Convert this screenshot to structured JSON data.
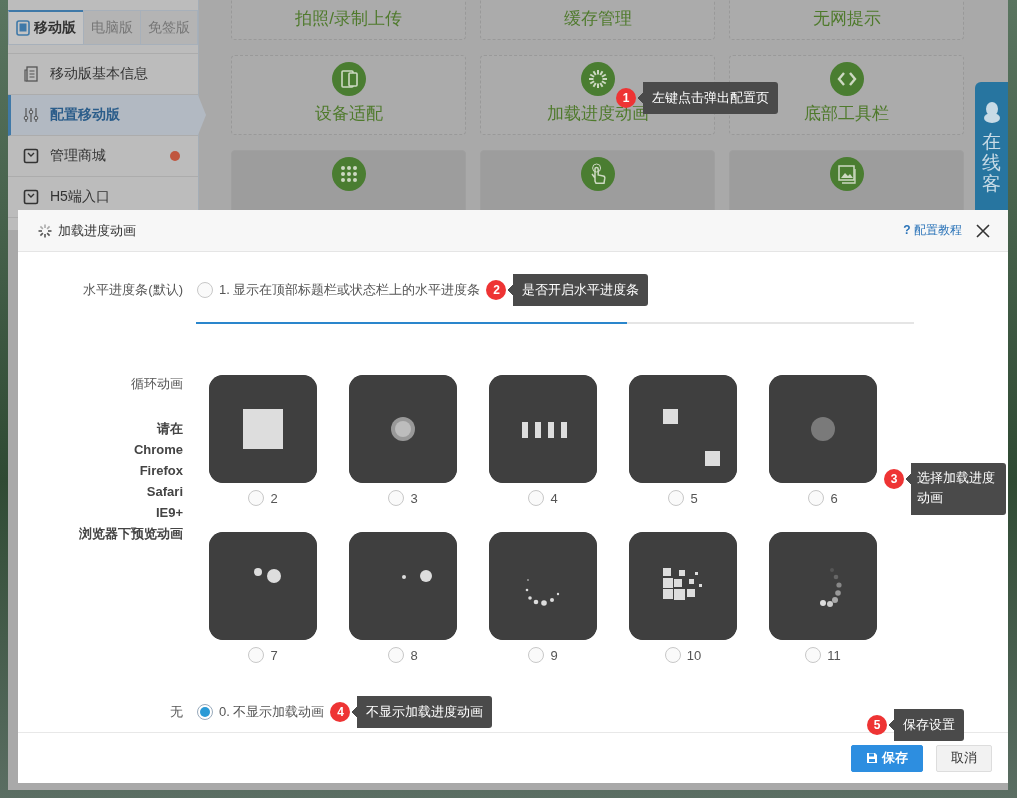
{
  "sidebar": {
    "tabs": [
      {
        "label": "移动版",
        "selected": true
      },
      {
        "label": "电脑版",
        "selected": false
      },
      {
        "label": "免签版",
        "selected": false
      }
    ],
    "items": [
      {
        "label": "移动版基本信息",
        "selected": false,
        "badge": false
      },
      {
        "label": "配置移动版",
        "selected": true,
        "badge": false
      },
      {
        "label": "管理商城",
        "selected": false,
        "badge": true
      },
      {
        "label": "H5端入口",
        "selected": false,
        "badge": false
      }
    ]
  },
  "features": [
    {
      "label": "拍照/录制上传",
      "kind": "outline"
    },
    {
      "label": "缓存管理",
      "kind": "outline"
    },
    {
      "label": "无网提示",
      "kind": "outline"
    },
    {
      "label": "设备适配",
      "kind": "outline"
    },
    {
      "label": "加载进度动画",
      "kind": "outline",
      "callout": {
        "number": "1",
        "text": "左键点击弹出配置页"
      }
    },
    {
      "label": "底部工具栏",
      "kind": "outline"
    },
    {
      "kind": "filled"
    },
    {
      "kind": "filled"
    },
    {
      "kind": "filled"
    }
  ],
  "online_service": {
    "label": "在线客"
  },
  "dialog": {
    "title": "加载进度动画",
    "help_link": "**?** 配置教程",
    "horizontal": {
      "label": "水平进度条(默认)",
      "option": "1. 显示在顶部标题栏或状态栏上的水平进度条",
      "selected": false,
      "callout": {
        "number": "2",
        "text": "是否开启水平进度条"
      }
    },
    "preview_bar": {
      "level": 0.6
    },
    "loop": {
      "label": "循环动画",
      "hint": "请在\nChrome\nFirefox\nSafari\nIE9+\n浏览器下预览动画",
      "options": [
        {
          "number": "2",
          "kind": "square",
          "selected": false
        },
        {
          "number": "3",
          "kind": "ring-dot",
          "selected": false
        },
        {
          "number": "4",
          "kind": "bars",
          "selected": false
        },
        {
          "number": "5",
          "kind": "two-squares",
          "selected": false
        },
        {
          "number": "6",
          "kind": "dot",
          "selected": false
        },
        {
          "number": "7",
          "kind": "two-dots",
          "selected": false
        },
        {
          "number": "8",
          "kind": "small-big-dot",
          "selected": false
        },
        {
          "number": "9",
          "kind": "dot-arc",
          "selected": false
        },
        {
          "number": "10",
          "kind": "square-cluster",
          "selected": false
        },
        {
          "number": "11",
          "kind": "fade-arc",
          "selected": false
        }
      ],
      "callout": {
        "number": "3",
        "text": "选择加载进度动画"
      }
    },
    "none": {
      "label": "无",
      "option": "0. 不显示加载动画",
      "selected": true,
      "callout": {
        "number": "4",
        "text": "不显示加载进度动画"
      }
    },
    "buttons": [
      {
        "label": "保存",
        "kind": "primary",
        "callout": {
          "number": "5",
          "text": "保存设置"
        }
      },
      {
        "label": "取消",
        "kind": "default"
      }
    ]
  }
}
